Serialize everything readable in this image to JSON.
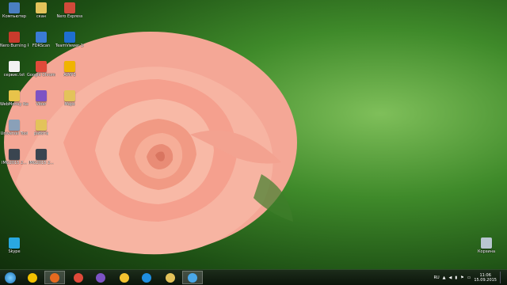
{
  "desktop": {
    "icons": [
      {
        "label": "Компьютер",
        "icon": "computer-icon",
        "color": "#4a7fc1"
      },
      {
        "label": "скан",
        "icon": "folder-icon",
        "color": "#e3c35a"
      },
      {
        "label": "Nero Express",
        "icon": "nero-express-icon",
        "color": "#d04a3a"
      },
      {
        "label": "Nero Burning ROM",
        "icon": "nero-burning-rom-icon",
        "color": "#c83b2c"
      },
      {
        "label": "FDRScan",
        "icon": "fdrscan-icon",
        "color": "#3a7bd5"
      },
      {
        "label": "TeamViewer 10",
        "icon": "teamviewer-icon",
        "color": "#1e6fd0"
      },
      {
        "label": "сервис.txt",
        "icon": "text-file-icon",
        "color": "#f2f2f2"
      },
      {
        "label": "Google Chrome",
        "icon": "chrome-icon",
        "color": "#e04a3a"
      },
      {
        "label": "AIMP3",
        "icon": "aimp-icon",
        "color": "#f0b400"
      },
      {
        "label": "WebMoney Keeper W...",
        "icon": "webmoney-icon",
        "color": "#e8c34a"
      },
      {
        "label": "Viber",
        "icon": "viber-icon",
        "color": "#7d53c4"
      },
      {
        "label": "Maps",
        "icon": "folder-icon",
        "color": "#e3c35a"
      },
      {
        "label": "Universal Tool",
        "icon": "universal-tool-icon",
        "color": "#8aa0b8"
      },
      {
        "label": "работа",
        "icon": "folder-icon",
        "color": "#e3c35a"
      },
      {
        "label": "IMG2015 2...",
        "icon": "image-file-icon",
        "color": "#3a4550"
      },
      {
        "label": "IMG2015 2...",
        "icon": "image-file-icon",
        "color": "#3a4550"
      },
      {
        "label": "Skype",
        "icon": "skype-icon",
        "color": "#29a8e0"
      },
      {
        "label": "Корзина",
        "icon": "recycle-bin-icon",
        "color": "#b8c6d0"
      }
    ]
  },
  "taskbar": {
    "start": {
      "icon": "start-orb-icon",
      "color": "#2a8fd8"
    },
    "pinned": [
      {
        "icon": "bug-app-icon",
        "color": "#f2c200",
        "active": false
      },
      {
        "icon": "firefox-icon",
        "color": "#e66a1f",
        "active": true
      },
      {
        "icon": "chrome-icon",
        "color": "#e04a3a",
        "active": false
      },
      {
        "icon": "viber-icon",
        "color": "#7d53c4",
        "active": false
      },
      {
        "icon": "smiley-app-icon",
        "color": "#f4c430",
        "active": false
      },
      {
        "icon": "internet-explorer-icon",
        "color": "#1f8fe0",
        "active": false
      },
      {
        "icon": "file-explorer-icon",
        "color": "#e3c35a",
        "active": false
      },
      {
        "icon": "remote-desktop-icon",
        "color": "#4aa8e8",
        "active": true
      }
    ],
    "tray": {
      "language": "RU",
      "time": "11:06",
      "date": "15.09.2015"
    }
  }
}
